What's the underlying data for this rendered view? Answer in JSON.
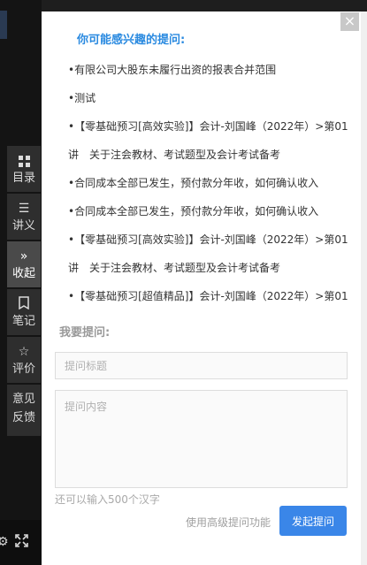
{
  "sidenav": {
    "items": [
      {
        "label": "目录",
        "icon": "grid-icon"
      },
      {
        "label": "讲义",
        "icon": "list-icon"
      },
      {
        "label": "收起",
        "icon": "collapse-icon",
        "active": true
      },
      {
        "label": "笔记",
        "icon": "note-icon"
      },
      {
        "label": "评价",
        "icon": "star-icon"
      },
      {
        "label": "意见",
        "label2": "反馈",
        "icon": "none"
      }
    ]
  },
  "panel": {
    "close_symbol": "×",
    "section_title": "你可能感兴趣的提问:",
    "questions": [
      "•有限公司大股东未履行出资的报表合并范围",
      "•测试",
      "•【零基础预习[高效实验]】会计-刘国峰（2022年）>第01",
      "讲　关于注会教材、考试题型及会计考试备考",
      "•合同成本全部已发生，预付款分年收，如何确认收入",
      "•合同成本全部已发生，预付款分年收，如何确认收入",
      "•【零基础预习[高效实验]】会计-刘国峰（2022年）>第01",
      "讲　关于注会教材、考试题型及会计考试备考",
      "•【零基础预习[超值精品]】会计-刘国峰（2022年）>第01"
    ],
    "ask_title": "我要提问:",
    "title_placeholder": "提问标题",
    "content_placeholder": "提问内容",
    "char_hint": "还可以输入500个汉字",
    "advanced_link": "使用高级提问功能",
    "submit_label": "发起提问"
  },
  "colors": {
    "accent": "#3a86e8",
    "title_blue": "#2a8ae0",
    "nav_bg": "#2e2e2e",
    "nav_active": "#4a4a4a"
  }
}
